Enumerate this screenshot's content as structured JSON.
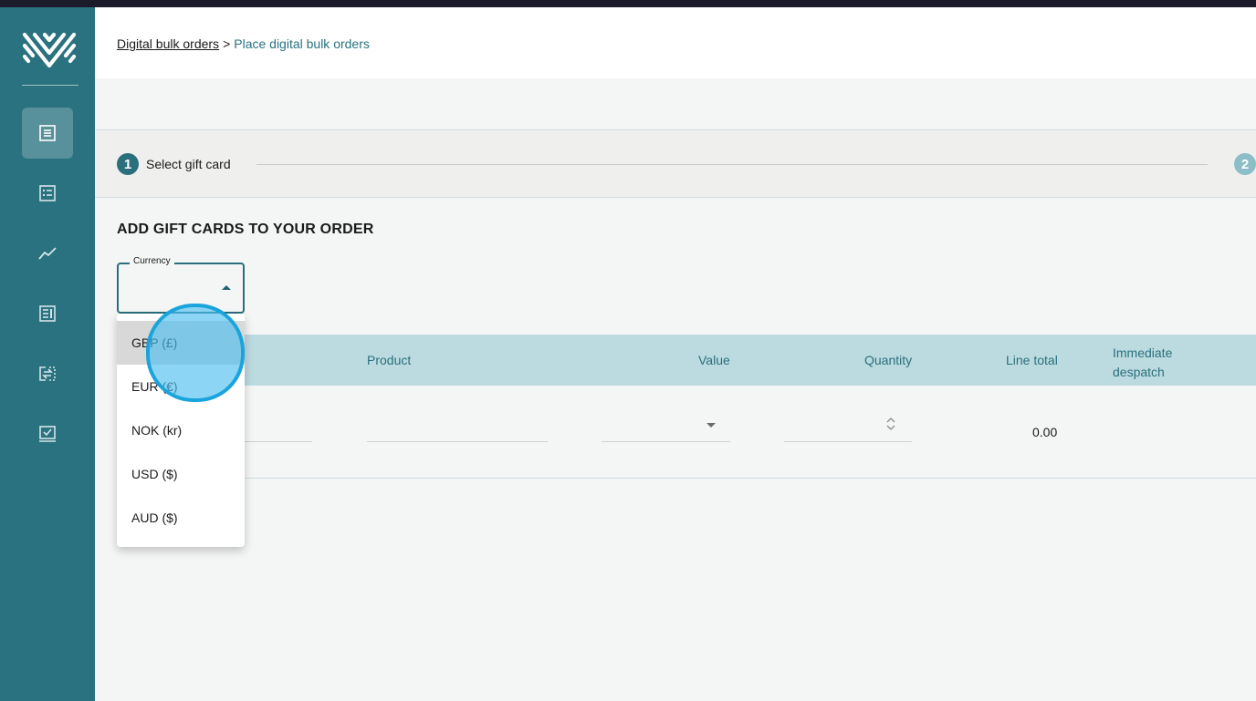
{
  "breadcrumb": {
    "parent": "Digital bulk orders",
    "separator": ">",
    "current": "Place digital bulk orders"
  },
  "stepper": {
    "step1_number": "1",
    "step1_label": "Select gift card",
    "step2_number": "2"
  },
  "section_title": "ADD GIFT CARDS TO YOUR ORDER",
  "currency": {
    "label": "Currency",
    "options": [
      "GBP (£)",
      "EUR (€)",
      "NOK (kr)",
      "USD ($)",
      "AUD ($)"
    ],
    "highlighted_index": 0
  },
  "table": {
    "headers": {
      "product": "Product",
      "value": "Value",
      "quantity": "Quantity",
      "line_total": "Line total",
      "immediate_despatch": "Immediate despatch"
    },
    "row": {
      "line_total": "0.00"
    }
  },
  "sidebar": {
    "items": [
      {
        "icon": "orders-list-icon",
        "active": true
      },
      {
        "icon": "checklist-icon",
        "active": false
      },
      {
        "icon": "line-chart-icon",
        "active": false
      },
      {
        "icon": "report-icon",
        "active": false
      },
      {
        "icon": "transfer-icon",
        "active": false
      },
      {
        "icon": "approved-icon",
        "active": false
      }
    ]
  },
  "colors": {
    "sidebar": "#2a727f",
    "accent": "#2a6f7c",
    "table_header": "#bcdbe0",
    "click_indicator": "#1aa4dc"
  }
}
